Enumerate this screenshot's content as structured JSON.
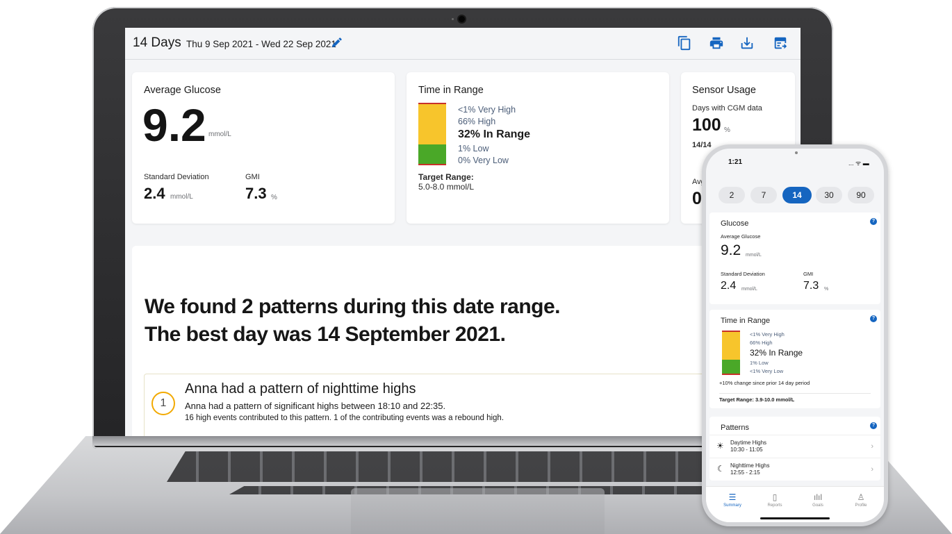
{
  "colors": {
    "very_high": "#c8312a",
    "high": "#f7c52c",
    "in_range": "#4aa828",
    "low": "#c8312a",
    "accent": "#1565c0",
    "pattern_ring": "#f2a900"
  },
  "laptop": {
    "header": {
      "range_label": "14 Days",
      "date_range": "Thu 9 Sep 2021 - Wed 22 Sep 2021",
      "icons": [
        "edit-icon",
        "copy-icon",
        "print-icon",
        "download-icon",
        "export-icon"
      ]
    },
    "average_glucose": {
      "title": "Average Glucose",
      "value": "9.2",
      "unit": "mmol/L",
      "sd_label": "Standard Deviation",
      "sd_value": "2.4",
      "sd_unit": "mmol/L",
      "gmi_label": "GMI",
      "gmi_value": "7.3",
      "gmi_unit": "%"
    },
    "time_in_range": {
      "title": "Time in Range",
      "very_high": "<1% Very High",
      "high": "66% High",
      "in_range": "32% In Range",
      "low": "1% Low",
      "very_low": "0% Very Low",
      "target_label": "Target Range:",
      "target_value": "5.0-8.0 mmol/L",
      "fractions": {
        "high": 0.66,
        "in_range": 0.32,
        "low": 0.01
      }
    },
    "sensor_usage": {
      "title": "Sensor Usage",
      "days_label": "Days with CGM data",
      "days_value": "100",
      "days_unit": "%",
      "days_ratio": "14/14",
      "avg_label": "Avg",
      "avg_value": "0"
    },
    "patterns": {
      "headline_1": "We found 2 patterns during this date range.",
      "headline_2": "The best day was 14 September 2021.",
      "first": {
        "number": "1",
        "title": "Anna had a pattern of nighttime highs",
        "description": "Anna had a pattern of significant highs between 18:10 and 22:35.",
        "detail": "16 high events contributed to this pattern. 1 of the contributing events was a rebound high."
      }
    }
  },
  "phone": {
    "status_time": "1:21",
    "status_icons": "... ᯤ ▬",
    "range_chips": [
      "2",
      "7",
      "14",
      "30",
      "90"
    ],
    "active_chip": "14",
    "glucose": {
      "title": "Glucose",
      "avg_label": "Average Glucose",
      "avg_value": "9.2",
      "avg_unit": "mmol/L",
      "sd_label": "Standard Deviation",
      "sd_value": "2.4",
      "sd_unit": "mmol/L",
      "gmi_label": "GMI",
      "gmi_value": "7.3",
      "gmi_unit": "%"
    },
    "time_in_range": {
      "title": "Time in Range",
      "very_high": "<1% Very High",
      "high": "66% High",
      "in_range": "32% In Range",
      "low": "1% Low",
      "very_low": "<1% Very Low",
      "change": "+10% change since prior 14 day period",
      "target": "Target Range: 3.9-10.0 mmol/L"
    },
    "patterns": {
      "title": "Patterns",
      "items": [
        {
          "label": "Daytime Highs",
          "time": "10:30 - 11:05",
          "icon": "sun-icon"
        },
        {
          "label": "Nighttime Highs",
          "time": "12:55 - 2:15",
          "icon": "moon-icon"
        }
      ]
    },
    "nav": [
      {
        "label": "Summary",
        "icon": "summary-icon"
      },
      {
        "label": "Reports",
        "icon": "reports-icon"
      },
      {
        "label": "Goals",
        "icon": "goals-icon"
      },
      {
        "label": "Profile",
        "icon": "profile-icon"
      }
    ]
  }
}
